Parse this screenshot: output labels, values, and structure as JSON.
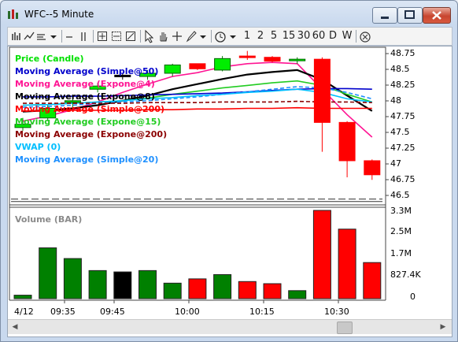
{
  "window": {
    "title": "WFC--5 Minute"
  },
  "toolbar": {
    "periods": [
      "1",
      "2",
      "5",
      "15",
      "30",
      "60",
      "D",
      "W"
    ]
  },
  "legend": [
    {
      "label": "Price (Candle)",
      "color": "#00e000"
    },
    {
      "label": "Moving Average (Simple@50)",
      "color": "#0000cc"
    },
    {
      "label": "Moving Average (Expone@4)",
      "color": "#ff1493"
    },
    {
      "label": "Moving Average (Expone@8)",
      "color": "#000000"
    },
    {
      "label": "Moving Average (Simple@200)",
      "color": "#ff0000"
    },
    {
      "label": "Moving Average (Expone@15)",
      "color": "#22cc22"
    },
    {
      "label": "Moving Average (Expone@200)",
      "color": "#8b0000"
    },
    {
      "label": "VWAP (0)",
      "color": "#00bfff"
    },
    {
      "label": "Moving Average (Simple@20)",
      "color": "#1e90ff"
    }
  ],
  "volume_label": "Volume (BAR)",
  "price_axis": [
    "48.75",
    "48.5",
    "48.25",
    "48",
    "47.75",
    "47.5",
    "47.25",
    "47",
    "46.75",
    "46.5"
  ],
  "volume_axis": [
    "3.3M",
    "2.5M",
    "1.7M",
    "827.4K",
    "0"
  ],
  "time_axis": [
    "4/12",
    "09:35",
    "09:45",
    "10:00",
    "10:15",
    "10:30"
  ],
  "chart_data": {
    "type": "candlestick",
    "price_ylim": [
      46.45,
      48.82
    ],
    "volume_ylim": [
      0,
      3300000
    ],
    "candles": [
      {
        "o": 47.65,
        "h": 47.75,
        "l": 47.55,
        "c": 47.6,
        "color": "green"
      },
      {
        "o": 47.75,
        "h": 47.95,
        "l": 47.7,
        "c": 47.9,
        "color": "green"
      },
      {
        "o": 48.0,
        "h": 48.05,
        "l": 47.9,
        "c": 48.02,
        "color": "green"
      },
      {
        "o": 48.2,
        "h": 48.3,
        "l": 48.15,
        "c": 48.25,
        "color": "green"
      },
      {
        "o": 48.4,
        "h": 48.45,
        "l": 48.35,
        "c": 48.42,
        "color": "black"
      },
      {
        "o": 48.4,
        "h": 48.5,
        "l": 48.35,
        "c": 48.45,
        "color": "green"
      },
      {
        "o": 48.45,
        "h": 48.6,
        "l": 48.4,
        "c": 48.58,
        "color": "green"
      },
      {
        "o": 48.6,
        "h": 48.6,
        "l": 48.5,
        "c": 48.52,
        "color": "red"
      },
      {
        "o": 48.5,
        "h": 48.72,
        "l": 48.48,
        "c": 48.68,
        "color": "green"
      },
      {
        "o": 48.72,
        "h": 48.8,
        "l": 48.66,
        "c": 48.7,
        "color": "red"
      },
      {
        "o": 48.7,
        "h": 48.72,
        "l": 48.62,
        "c": 48.64,
        "color": "red"
      },
      {
        "o": 48.65,
        "h": 48.7,
        "l": 48.6,
        "c": 48.67,
        "color": "green"
      },
      {
        "o": 48.67,
        "h": 48.7,
        "l": 47.22,
        "c": 47.68,
        "color": "red"
      },
      {
        "o": 47.68,
        "h": 47.7,
        "l": 46.82,
        "c": 47.08,
        "color": "red"
      },
      {
        "o": 47.08,
        "h": 47.1,
        "l": 46.78,
        "c": 46.86,
        "color": "red"
      }
    ],
    "volumes": [
      {
        "v": 130000,
        "color": "green"
      },
      {
        "v": 1900000,
        "color": "green"
      },
      {
        "v": 1500000,
        "color": "green"
      },
      {
        "v": 1050000,
        "color": "green"
      },
      {
        "v": 1000000,
        "color": "black"
      },
      {
        "v": 1050000,
        "color": "green"
      },
      {
        "v": 580000,
        "color": "green"
      },
      {
        "v": 740000,
        "color": "red"
      },
      {
        "v": 900000,
        "color": "green"
      },
      {
        "v": 640000,
        "color": "red"
      },
      {
        "v": 560000,
        "color": "red"
      },
      {
        "v": 300000,
        "color": "green"
      },
      {
        "v": 3300000,
        "color": "red"
      },
      {
        "v": 2600000,
        "color": "red"
      },
      {
        "v": 1350000,
        "color": "red"
      }
    ],
    "moving_averages": [
      {
        "name": "Moving Average (Expone@4)",
        "color": "#ff1493",
        "values": [
          47.7,
          47.78,
          47.88,
          48.0,
          48.15,
          48.28,
          48.4,
          48.46,
          48.55,
          48.6,
          48.62,
          48.6,
          48.2,
          47.8,
          47.45
        ]
      },
      {
        "name": "Moving Average (Expone@8)",
        "color": "#000000",
        "values": [
          47.85,
          47.87,
          47.9,
          47.95,
          48.02,
          48.1,
          48.2,
          48.28,
          48.36,
          48.43,
          48.47,
          48.5,
          48.35,
          48.1,
          47.86
        ]
      },
      {
        "name": "Moving Average (Expone@15)",
        "color": "#22cc22",
        "values": [
          47.95,
          47.96,
          47.98,
          48.0,
          48.02,
          48.06,
          48.12,
          48.17,
          48.22,
          48.26,
          48.3,
          48.33,
          48.26,
          48.12,
          48.0
        ]
      },
      {
        "name": "Moving Average (Simple@50)",
        "color": "#0000cc",
        "values": [
          48.08,
          48.08,
          48.09,
          48.09,
          48.1,
          48.11,
          48.12,
          48.13,
          48.14,
          48.16,
          48.18,
          48.2,
          48.21,
          48.21,
          48.2
        ]
      },
      {
        "name": "Moving Average (Simple@20)",
        "color": "#1e90ff",
        "values": [
          47.92,
          47.93,
          47.95,
          47.98,
          48.0,
          48.02,
          48.05,
          48.08,
          48.12,
          48.16,
          48.2,
          48.24,
          48.22,
          48.15,
          48.05
        ]
      },
      {
        "name": "VWAP (0)",
        "color": "#00bfff",
        "values": [
          47.95,
          47.96,
          47.98,
          48.0,
          48.02,
          48.05,
          48.07,
          48.1,
          48.12,
          48.15,
          48.17,
          48.2,
          48.15,
          48.05,
          48.0
        ]
      },
      {
        "name": "Moving Average (Simple@200)",
        "color": "#ff0000",
        "values": [
          47.86,
          47.86,
          47.87,
          47.87,
          47.87,
          47.88,
          47.88,
          47.89,
          47.89,
          47.9,
          47.9,
          47.91,
          47.9,
          47.9,
          47.9
        ]
      },
      {
        "name": "Moving Average (Expone@200)",
        "color": "#8b0000",
        "values": [
          47.98,
          47.98,
          47.98,
          47.98,
          47.98,
          47.99,
          47.99,
          47.99,
          48.0,
          48.0,
          48.0,
          48.01,
          48.0,
          48.0,
          47.99
        ]
      }
    ]
  }
}
